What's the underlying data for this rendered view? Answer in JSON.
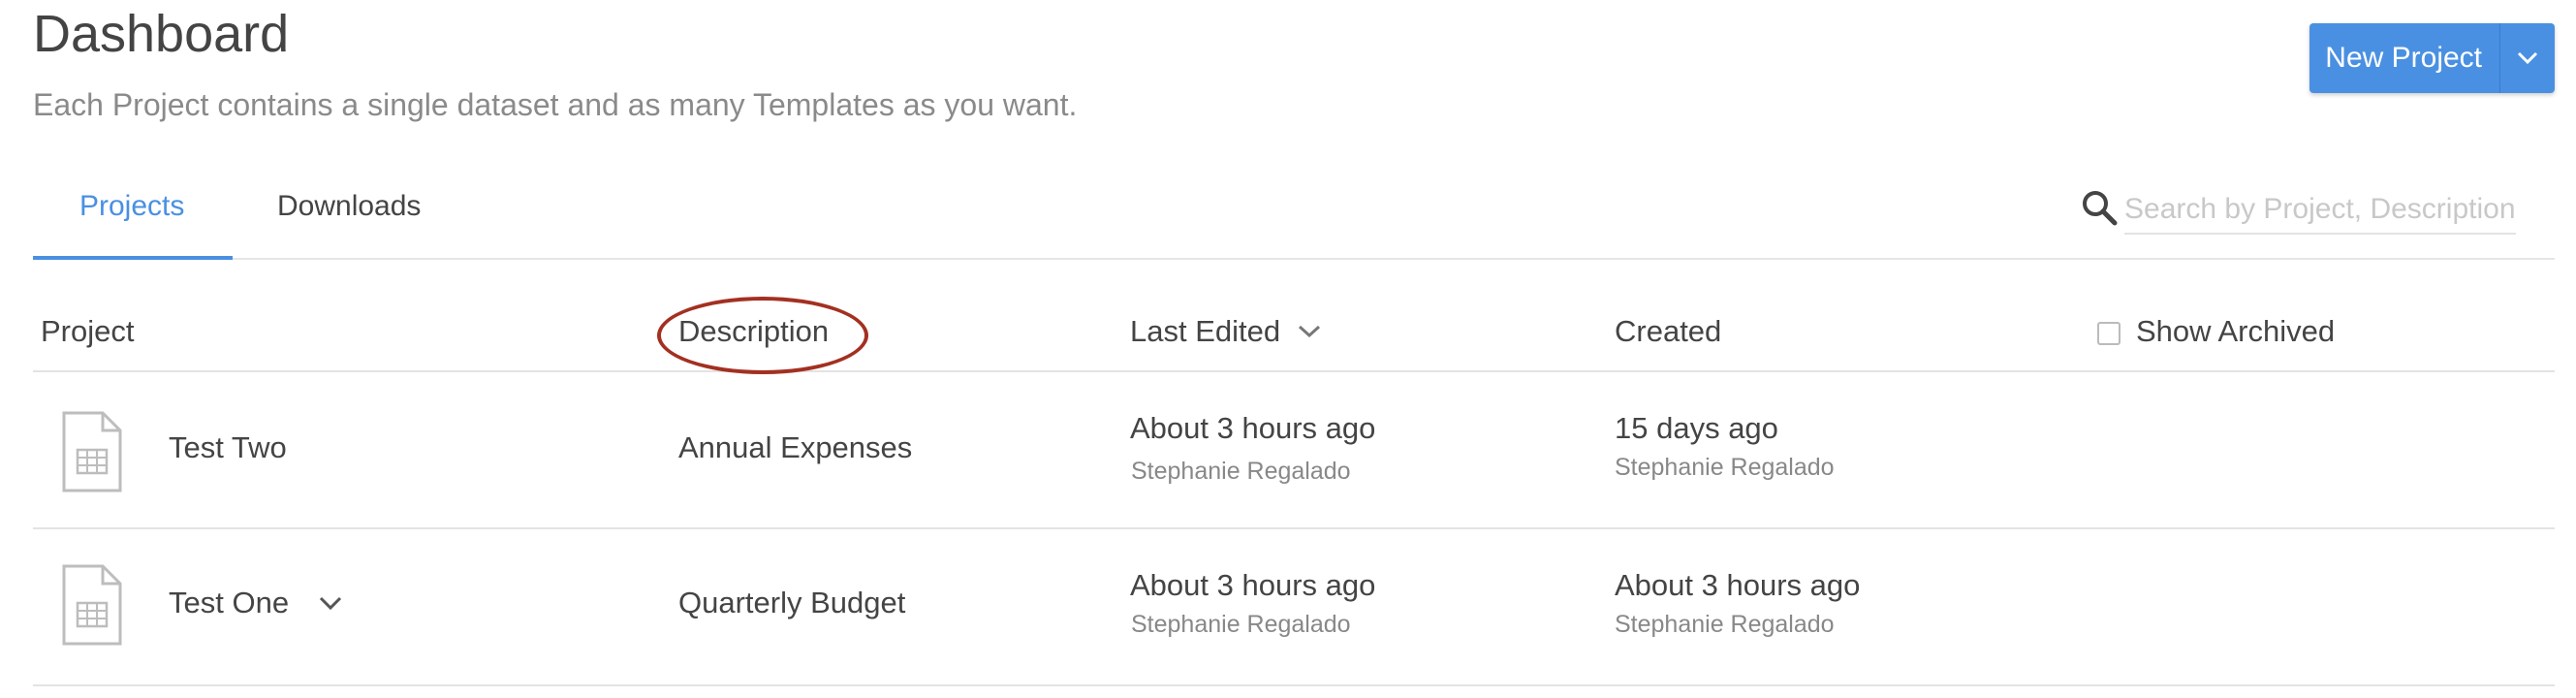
{
  "header": {
    "title": "Dashboard",
    "subtitle": "Each Project contains a single dataset and as many Templates as you want.",
    "new_project_label": "New Project"
  },
  "tabs": [
    {
      "label": "Projects",
      "active": true
    },
    {
      "label": "Downloads",
      "active": false
    }
  ],
  "search": {
    "placeholder": "Search by Project, Description"
  },
  "table": {
    "columns": {
      "project": "Project",
      "description": "Description",
      "last_edited": "Last Edited",
      "created": "Created",
      "show_archived": "Show Archived"
    },
    "rows": [
      {
        "name": "Test Two",
        "description": "Annual Expenses",
        "last_edited": "About 3 hours ago",
        "last_edited_by": "Stephanie Regalado",
        "created": "15 days ago",
        "created_by": "Stephanie Regalado"
      },
      {
        "name": "Test One",
        "description": "Quarterly Budget",
        "last_edited": "About 3 hours ago",
        "last_edited_by": "Stephanie Regalado",
        "created": "About 3 hours ago",
        "created_by": "Stephanie Regalado"
      }
    ]
  },
  "colors": {
    "accent": "#4a90e2",
    "annotation": "#a33021"
  }
}
